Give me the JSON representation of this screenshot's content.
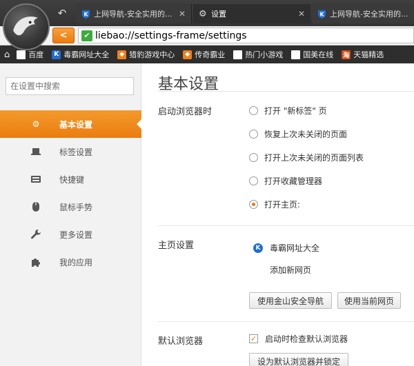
{
  "tabs": [
    {
      "title": "上网导航-安全实用的...",
      "icon": "k-shield-icon",
      "active": false
    },
    {
      "title": "设置",
      "icon": "gear-icon",
      "active": true
    },
    {
      "title": "上网导航-安全实用的...",
      "icon": "k-shield-icon",
      "active": false
    }
  ],
  "tab_close": "✕",
  "address": {
    "url": "liebao://settings-frame/settings"
  },
  "bookmarks": [
    {
      "label": "百度",
      "icon": "document-icon"
    },
    {
      "label": "毒霸网址大全",
      "icon": "k-shield-icon"
    },
    {
      "label": "猎豹游戏中心",
      "icon": "cheetah-icon"
    },
    {
      "label": "传奇霸业",
      "icon": "cheetah-icon"
    },
    {
      "label": "热门小游戏",
      "icon": "document-icon"
    },
    {
      "label": "国美在线",
      "icon": "document-icon"
    },
    {
      "label": "天猫精选",
      "icon": "tmall-icon"
    }
  ],
  "sidebar": {
    "search_placeholder": "在设置中搜索",
    "items": [
      {
        "label": "基本设置",
        "icon": "gear-icon",
        "active": true
      },
      {
        "label": "标签设置",
        "icon": "laptop-icon",
        "active": false
      },
      {
        "label": "快捷键",
        "icon": "keyboard-icon",
        "active": false
      },
      {
        "label": "鼠标手势",
        "icon": "mouse-icon",
        "active": false
      },
      {
        "label": "更多设置",
        "icon": "wrench-icon",
        "active": false
      },
      {
        "label": "我的应用",
        "icon": "puzzle-icon",
        "active": false
      }
    ]
  },
  "main": {
    "title": "基本设置",
    "startup": {
      "label": "启动浏览器时",
      "options": [
        {
          "label": "打开 \"新标签\" 页",
          "checked": false
        },
        {
          "label": "恢复上次未关闭的页面",
          "checked": false
        },
        {
          "label": "打开上次未关闭的页面列表",
          "checked": false
        },
        {
          "label": "打开收藏管理器",
          "checked": false
        },
        {
          "label": "打开主页:",
          "checked": true
        }
      ]
    },
    "homepage": {
      "label": "主页设置",
      "current": "毒霸网址大全",
      "add_page": "添加新网页",
      "btn_use_jinshan": "使用金山安全导航",
      "btn_use_current": "使用当前网页"
    },
    "default_browser": {
      "label": "默认浏览器",
      "check_label": "启动时检查默认浏览器",
      "checked": true,
      "btn_set_default": "设为默认浏览器并锁定"
    }
  },
  "colors": {
    "accent": "#ee7a10",
    "secure": "#3bab3b",
    "chrome_dark": "#2e2e2e"
  }
}
